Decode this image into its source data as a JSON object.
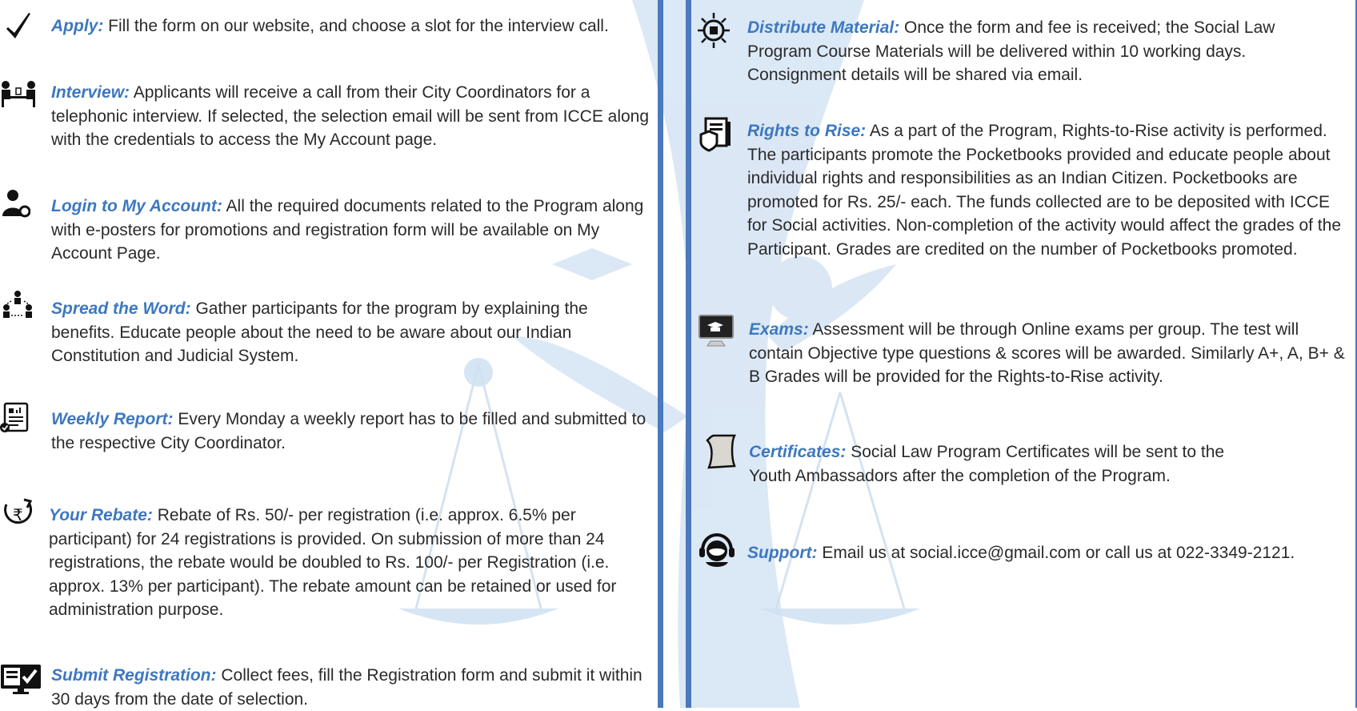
{
  "left_column": {
    "steps": [
      {
        "icon": "checkmark-icon",
        "title": "Apply:",
        "text": " Fill the form on our website, and choose a slot for the interview call."
      },
      {
        "icon": "interview-icon",
        "title": "Interview:",
        "text": " Applicants will receive a call from their City Coordinators for a telephonic interview. If selected, the selection email will be sent from ICCE along with the credentials to access the My Account page."
      },
      {
        "icon": "user-settings-icon",
        "title": "Login to My Account:",
        "text": " All the required documents related to the Program along with e-posters for promotions and registration form will be available on My Account Page."
      },
      {
        "icon": "people-network-icon",
        "title": "Spread the Word:",
        "text": " Gather participants for the program by explaining the benefits. Educate people about the need to be aware about our Indian Constitution and Judicial System."
      },
      {
        "icon": "report-icon",
        "title": "Weekly Report:",
        "text": " Every Monday a weekly report has to be filled and submitted to the respective City Coordinator."
      },
      {
        "icon": "rupee-refund-icon",
        "title": "Your Rebate:",
        "text": " Rebate of Rs. 50/- per registration (i.e. approx. 6.5% per participant) for 24 registrations is provided. On submission of more than 24 registrations, the rebate would be doubled to Rs. 100/- per Registration (i.e. approx. 13% per participant). The rebate amount can be retained or used for administration purpose."
      },
      {
        "icon": "monitor-check-icon",
        "title": "Submit Registration:",
        "text": "  Collect fees, fill the Registration form and submit it within 30 days from the date of selection."
      }
    ]
  },
  "right_column": {
    "steps": [
      {
        "icon": "distribute-icon",
        "title": "Distribute Material:",
        "text": " Once the form and fee is received; the Social Law Program Course Materials will be delivered within 10 working days. Consignment details will be shared via email."
      },
      {
        "icon": "document-shield-icon",
        "title": "Rights to Rise:",
        "text": " As a part of the Program, Rights-to-Rise activity is performed. The participants promote the Pocketbooks provided and educate people about individual rights and responsibilities as an Indian Citizen. Pocketbooks are promoted for Rs. 25/- each. The funds collected are to be deposited with ICCE for Social activities. Non-completion of the activity would affect the grades of the Participant. Grades are credited on the number of Pocketbooks promoted."
      },
      {
        "icon": "exam-monitor-icon",
        "title": "Exams:",
        "text": " Assessment will be through Online exams per group. The test will contain Objective type questions & scores will be awarded. Similarly A+, A, B+ & B Grades will be provided for the Rights-to-Rise activity."
      },
      {
        "icon": "certificate-scroll-icon",
        "title": "Certificates:",
        "text": " Social Law Program Certificates will be sent to the Youth Ambassadors after the completion of the Program."
      },
      {
        "icon": "headset-support-icon",
        "title": "Support:",
        "text": " Email us at social.icce@gmail.com or call us at 022-3349-2121."
      }
    ]
  },
  "colors": {
    "accent": "#3d78c0",
    "divider": "#4a79bd",
    "watermark": "#c9dcef"
  }
}
